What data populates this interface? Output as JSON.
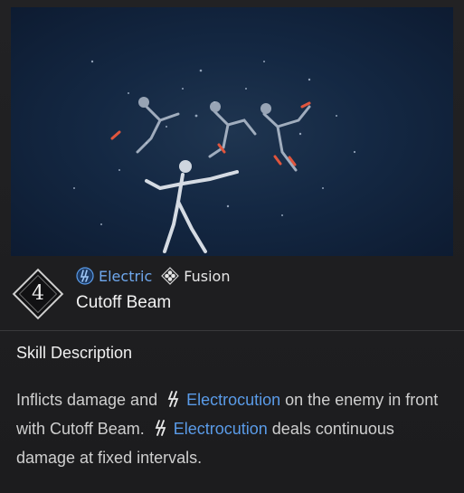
{
  "preview": {
    "image_alt": "Skill preview: figures hit by a beam attack"
  },
  "skill": {
    "level": "4",
    "tags": [
      {
        "label": "Electric",
        "icon": "electric-icon",
        "color": "#6fa8ee"
      },
      {
        "label": "Fusion",
        "icon": "fusion-icon",
        "color": "#e6e6e6"
      }
    ],
    "name": "Cutoff Beam"
  },
  "description": {
    "title": "Skill Description",
    "parts": {
      "p1": "Inflicts damage and",
      "kw1": "Electrocution",
      "p2": " on the enemy in front with Cutoff Beam.",
      "kw2": "Electrocution",
      "p3": " deals continuous damage at fixed intervals."
    },
    "keyword_color": "#5a9be8"
  }
}
